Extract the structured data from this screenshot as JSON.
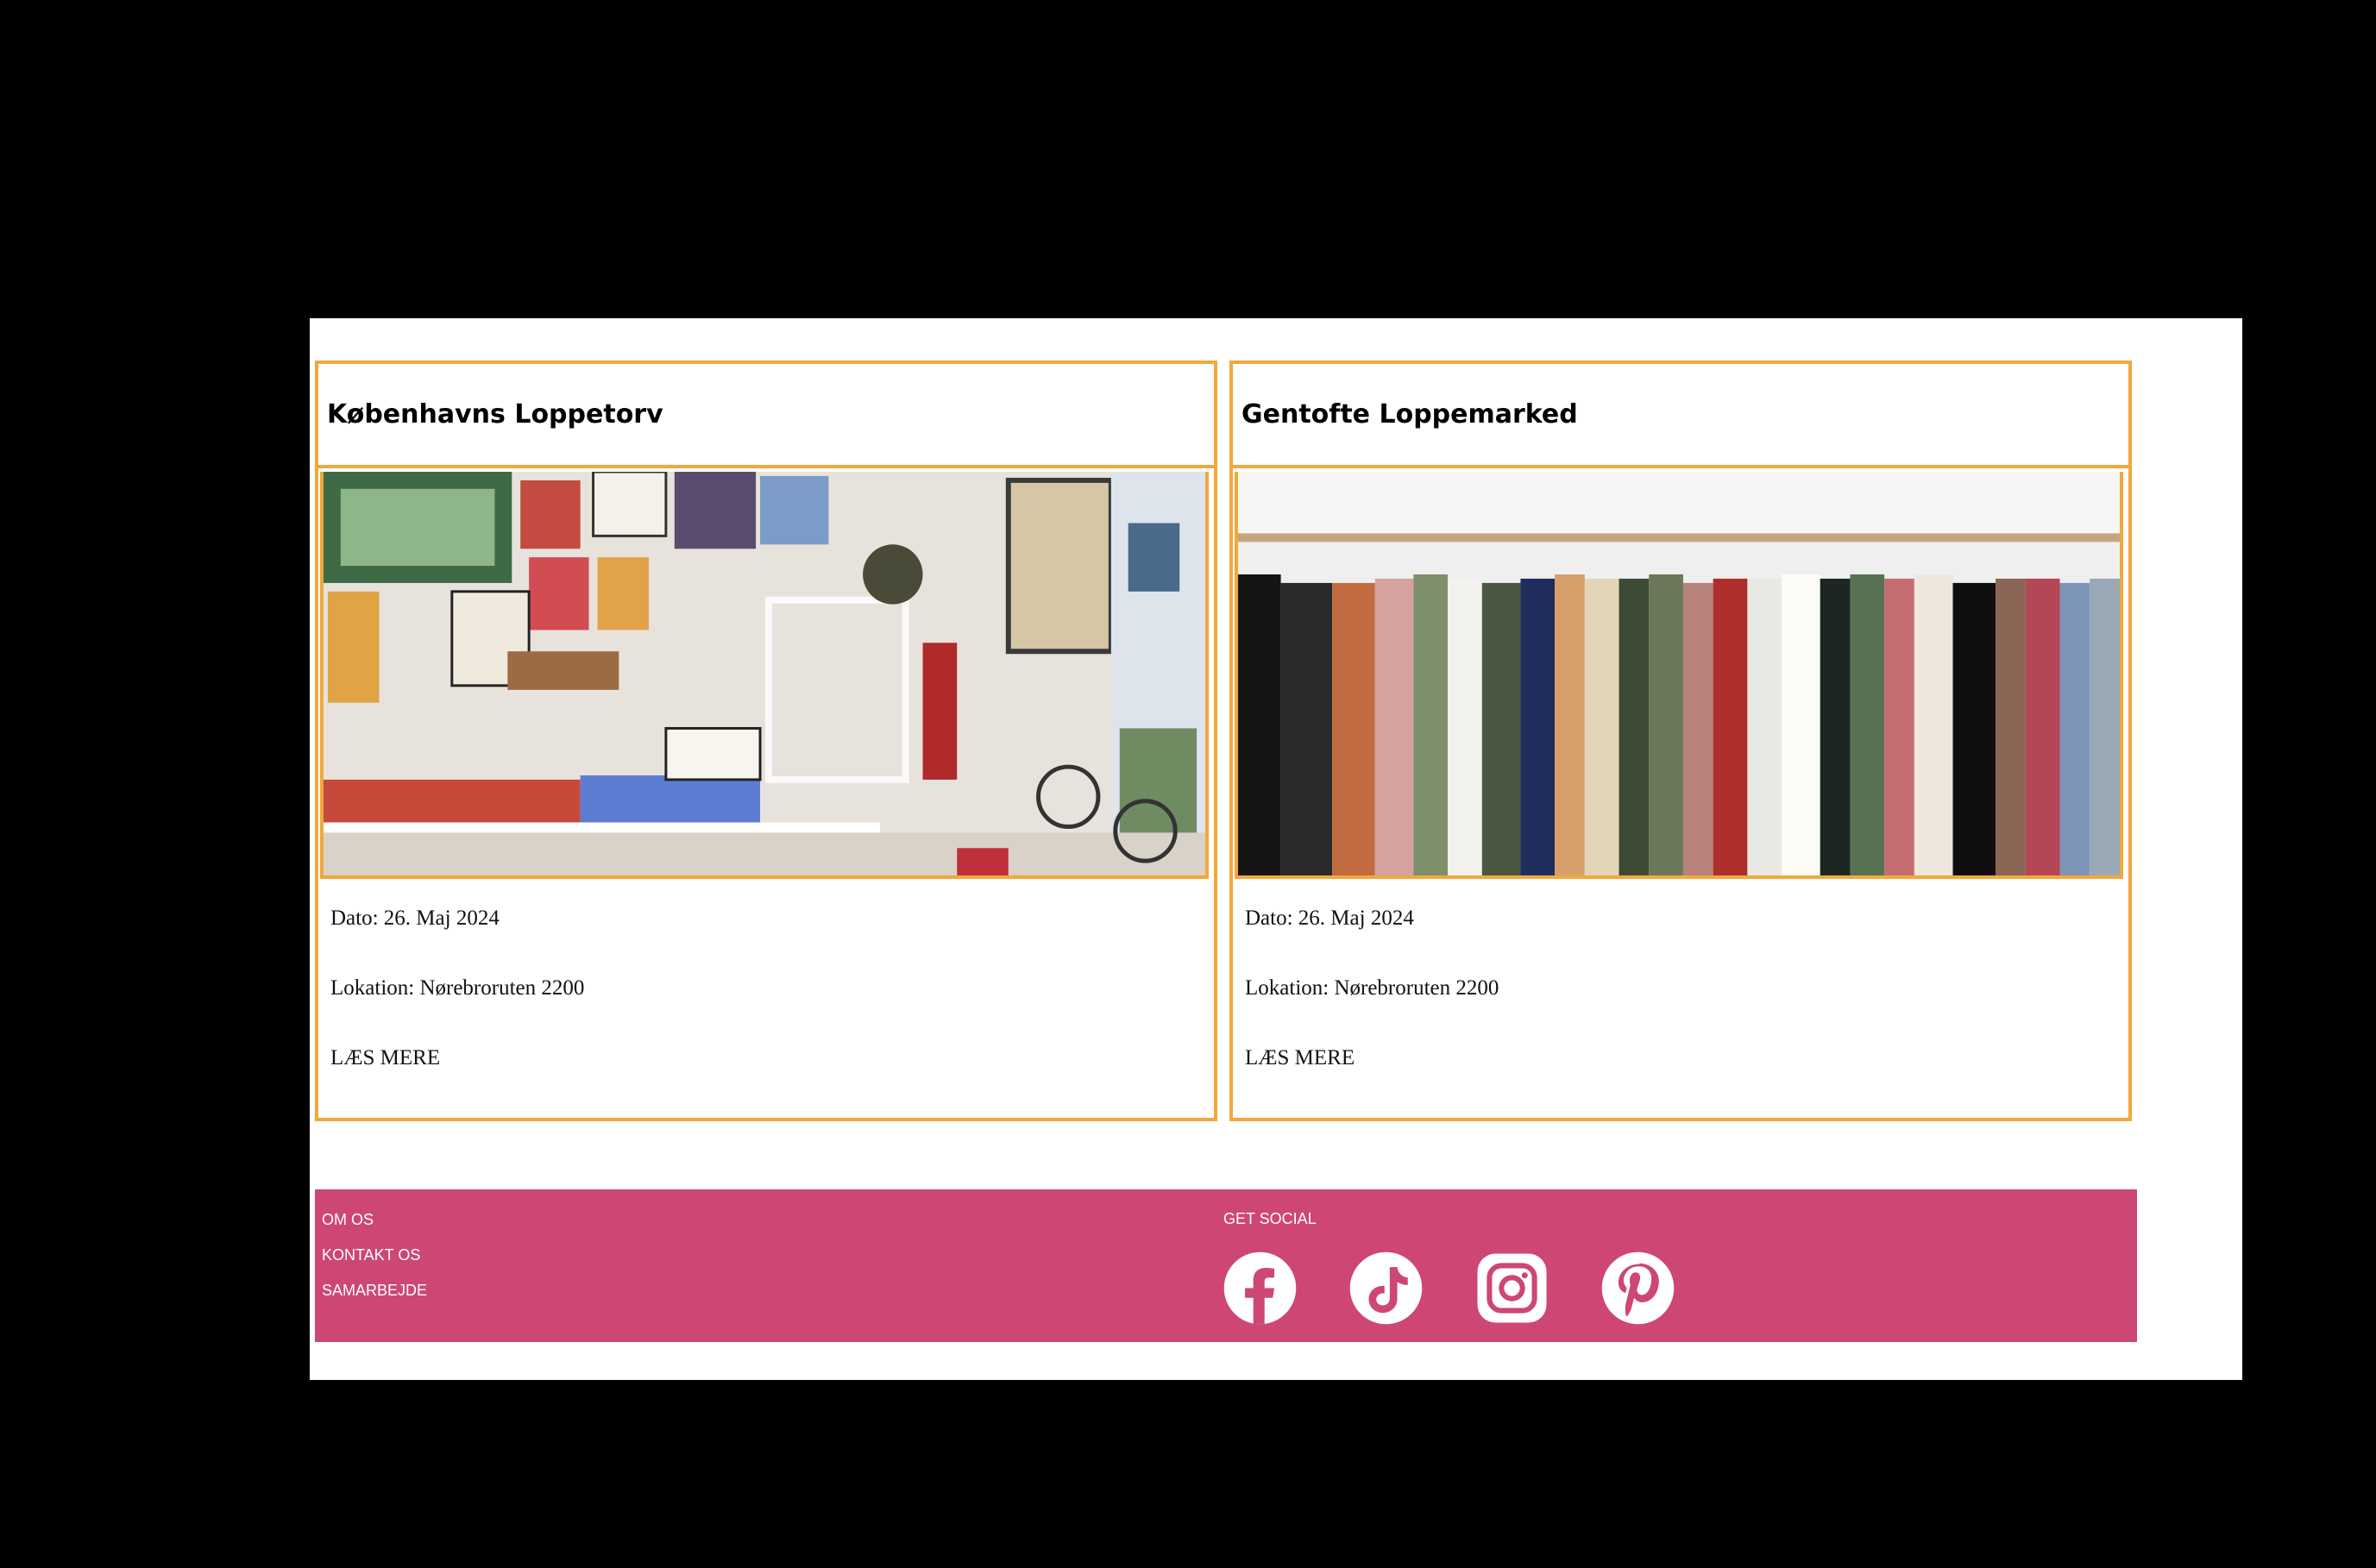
{
  "cards": [
    {
      "title": "Københavns Loppetorv",
      "image": "shop-interior-photo",
      "date": "Dato: 26. Maj 2024",
      "location": "Lokation: Nørebroruten 2200",
      "more": "LÆS MERE"
    },
    {
      "title": "Gentofte Loppemarked",
      "image": "clothing-rack-photo",
      "date": "Dato: 26. Maj 2024",
      "location": "Lokation: Nørebroruten 2200",
      "more": "LÆS MERE"
    }
  ],
  "footer": {
    "links": [
      "OM OS",
      "KONTAKT OS",
      "SAMARBEJDE"
    ],
    "social_label": "GET SOCIAL",
    "social_icons": [
      "facebook-icon",
      "tiktok-icon",
      "instagram-icon",
      "pinterest-icon"
    ]
  },
  "colors": {
    "card_border": "#f2a83b",
    "footer_bg": "#cd4676",
    "page_bg": "#ffffff",
    "outside_bg": "#000000"
  }
}
